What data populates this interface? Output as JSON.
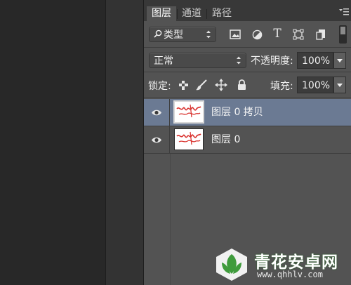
{
  "tabs": [
    {
      "label": "图层",
      "active": true
    },
    {
      "label": "通道",
      "active": false
    },
    {
      "label": "路径",
      "active": false
    }
  ],
  "filter": {
    "kind_label": "类型",
    "icons": [
      "image-filter-icon",
      "adjustment-filter-icon",
      "type-filter-icon",
      "shape-filter-icon",
      "smart-object-filter-icon"
    ]
  },
  "blend": {
    "mode": "正常",
    "opacity_label": "不透明度:",
    "opacity_value": "100%"
  },
  "lock": {
    "label": "锁定:",
    "fill_label": "填充:",
    "fill_value": "100%"
  },
  "layers": [
    {
      "name": "图层 0 拷贝",
      "selected": true,
      "visible": true
    },
    {
      "name": "图层 0",
      "selected": false,
      "visible": true
    }
  ],
  "watermark": {
    "title": "青花安卓网",
    "url": "www.qhhlv.com"
  },
  "colors": {
    "panel_bg": "#535353",
    "selected_layer": "#6b7a93",
    "thumb_scribble": "#d9302c"
  }
}
